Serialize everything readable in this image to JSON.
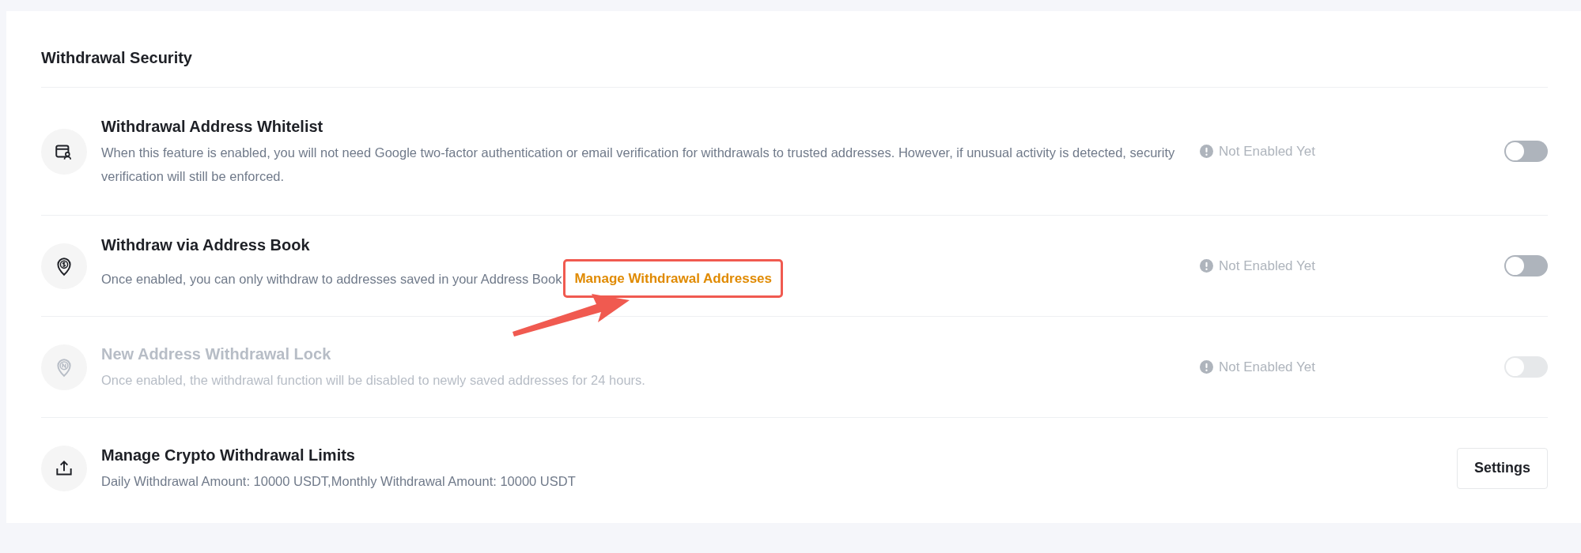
{
  "section": {
    "title": "Withdrawal Security"
  },
  "rows": [
    {
      "kind": "toggle",
      "title": "Withdrawal Address Whitelist",
      "description": "When this feature is enabled, you will not need Google two-factor authentication or email verification for withdrawals to trusted addresses. However, if unusual activity is detected, security verification will still be enforced.",
      "status": "Not Enabled Yet",
      "on": false,
      "disabled": false
    },
    {
      "kind": "toggle",
      "title": "Withdraw via Address Book",
      "description": "Once enabled, you can only withdraw to addresses saved in your Address Book",
      "link": {
        "label": "Manage Withdrawal Addresses",
        "highlighted": true
      },
      "status": "Not Enabled Yet",
      "on": false,
      "disabled": false
    },
    {
      "kind": "toggle",
      "title": "New Address Withdrawal Lock",
      "description": "Once enabled, the withdrawal function will be disabled to newly saved addresses for 24 hours.",
      "status": "Not Enabled Yet",
      "on": false,
      "disabled": true
    },
    {
      "kind": "button",
      "title": "Manage Crypto Withdrawal Limits",
      "description": "Daily Withdrawal Amount: 10000 USDT,Monthly Withdrawal Amount: 10000 USDT",
      "button": "Settings"
    }
  ]
}
